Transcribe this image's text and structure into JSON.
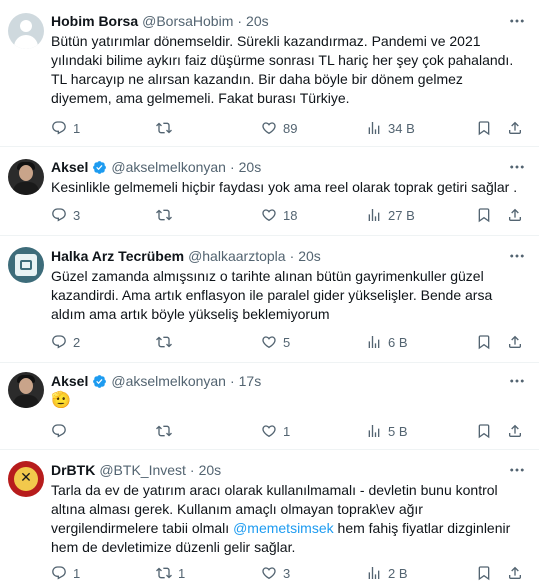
{
  "tweets": [
    {
      "name": "Hobim Borsa",
      "handle": "@BorsaHobim",
      "time": "20s",
      "verified": false,
      "text": "Bütün yatırımlar dönemseldir. Sürekli kazandırmaz. Pandemi ve 2021 yılındaki bilime aykırı faiz düşürme sonrası TL hariç her şey çok pahalandı. TL harcayıp ne alırsan kazandın. Bir daha böyle bir dönem gelmez diyemem, ama gelmemeli. Fakat burası Türkiye.",
      "replies": "1",
      "retweets": "",
      "likes": "89",
      "views": "34 B"
    },
    {
      "name": "Aksel",
      "handle": "@akselmelkonyan",
      "time": "20s",
      "verified": true,
      "text": "Kesinlikle gelmemeli hiçbir faydası yok ama reel olarak toprak getiri sağlar .",
      "replies": "3",
      "retweets": "",
      "likes": "18",
      "views": "27 B"
    },
    {
      "name": "Halka Arz Tecrübem",
      "handle": "@halkaarztopla",
      "time": "20s",
      "verified": false,
      "text": "Güzel zamanda almışsınız o tarihte alınan bütün gayrimenkuller güzel kazandirdi. Ama artık enflasyon ile paralel gider yükselişler. Bende arsa aldım ama artık böyle yükseliş beklemiyorum",
      "replies": "2",
      "retweets": "",
      "likes": "5",
      "views": "6 B"
    },
    {
      "name": "Aksel",
      "handle": "@akselmelkonyan",
      "time": "17s",
      "verified": true,
      "text": "🫡",
      "replies": "",
      "retweets": "",
      "likes": "1",
      "views": "5 B"
    },
    {
      "name": "DrBTK",
      "handle": "@BTK_Invest",
      "time": "20s",
      "verified": false,
      "text_before": "Tarla da ev de yatırım aracı olarak kullanılmamalı - devletin bunu kontrol altına alması gerek. Kullanım amaçlı olmayan toprak\\ev ağır vergilendirmelere tabii olmalı ",
      "mention": "@memetsimsek",
      "text_after": " hem fahiş fiyatlar dizginlenir hem de devletimize düzenli gelir sağlar.",
      "replies": "1",
      "retweets": "1",
      "likes": "3",
      "views": "2 B"
    }
  ],
  "colors": {
    "text": "#0f1419",
    "secondary": "#536471",
    "accent": "#1d9bf0",
    "divider": "#eff3f4"
  },
  "icons": [
    "reply-icon",
    "retweet-icon",
    "like-icon",
    "views-icon",
    "bookmark-icon",
    "share-icon",
    "more-icon",
    "verified-icon"
  ]
}
